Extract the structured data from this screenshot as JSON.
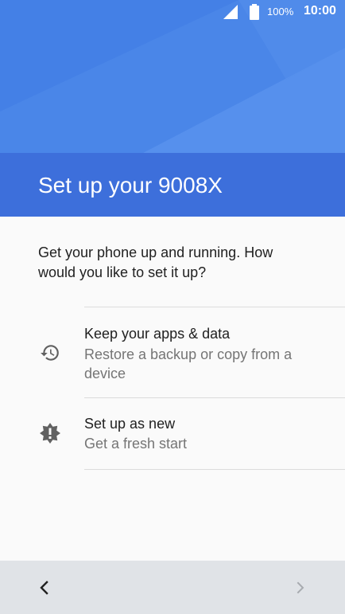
{
  "status_bar": {
    "battery_percent": "100%",
    "time": "10:00"
  },
  "header": {
    "title": "Set up your 9008X"
  },
  "intro": {
    "text": "Get your phone up and running. How would you like to set it up?"
  },
  "options": [
    {
      "title": "Keep your apps & data",
      "subtitle": "Restore a backup or copy from a device",
      "icon": "history-icon"
    },
    {
      "title": "Set up as new",
      "subtitle": "Get a fresh start",
      "icon": "alert-badge-icon"
    }
  ],
  "nav": {
    "back_icon": "chevron-left-icon",
    "next_icon": "chevron-right-icon",
    "next_enabled": false
  },
  "colors": {
    "header_blue": "#4a86e8",
    "title_band": "#3d6fdb",
    "nav_bar": "#e0e3e7"
  }
}
